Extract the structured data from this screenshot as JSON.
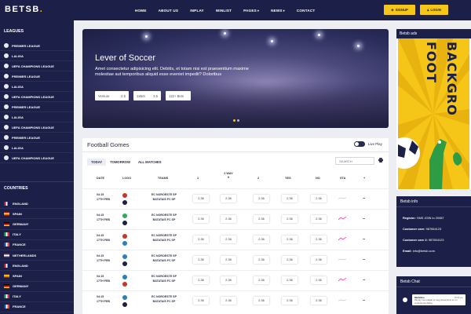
{
  "header": {
    "logo": "BETSB",
    "logo_dot": ".",
    "nav": [
      "HOME",
      "ABOUT US",
      "INPLAY",
      "WINLIST",
      "PAGES",
      "NEWS",
      "CONTACT"
    ],
    "nav_dropdowns": [
      "PAGES",
      "NEWS"
    ],
    "signup": "SIGNUP",
    "login": "LOGIN"
  },
  "sidebar": {
    "leagues_title": "LEAGUES",
    "leagues": [
      "PREMIER LEAGUE",
      "LALIGA",
      "UEFA CHAMPIONS LEAGUE",
      "PREMIER LEAGUE",
      "LALIGA",
      "UEFA CHAMPIONS LEAGUE",
      "PREMIER LEAGUE",
      "LALIGA",
      "UEFA CHAMPIONS LEAGUE",
      "PREMIER LEAGUE",
      "LALIGA",
      "UEFA CHAMPIONS LEAGUE"
    ],
    "countries_title": "COUNTRIES",
    "countries": [
      "ENGLAND",
      "SPAIN",
      "GERMANY",
      "ITALY",
      "FRANCE",
      "NETHERLANDS",
      "ENGLAND",
      "SPAIN",
      "GERMANY",
      "ITALY",
      "FRANCE"
    ]
  },
  "hero": {
    "title": "Lever of Soccer",
    "text": "Amet consectetur adipisicing elit. Debitis, et totam nisi est praesentium maxime molestiae aut temporibus aliquid esse eveniet impedit? Doloribus",
    "pills": [
      {
        "label": "Venture",
        "value": "2.5"
      },
      {
        "label": "1xBet",
        "value": "3.5"
      },
      {
        "label": "122+ Bets",
        "value": ""
      }
    ]
  },
  "games": {
    "title": "Football Gomes",
    "live_label": "Live Play",
    "tabs": [
      "TODAY",
      "TOMORROW",
      "ALL MATCHES"
    ],
    "search_placeholder": "SEARCH",
    "headers": {
      "date": "DATE",
      "logo": "LOGO",
      "teams": "TEAMS",
      "one": "1",
      "two_way": "2 WAY",
      "x": "X",
      "two": "2",
      "yes": "YES",
      "no": "NO",
      "sta": "STA",
      "plus": "+"
    },
    "rows": [
      {
        "time": "04:15",
        "date": "17TH FEB",
        "home": "EC NOROESTE SP",
        "away": "BATATAIS FC SP",
        "odds": [
          "2.36",
          "2.36",
          "2.36",
          "2.36",
          "2.36"
        ],
        "trend": "flat"
      },
      {
        "time": "04:15",
        "date": "17TH FEB",
        "home": "EC NOROESTE SP",
        "away": "BATATAIS FC SP",
        "odds": [
          "2.36",
          "2.36",
          "2.36",
          "2.36",
          "2.36"
        ],
        "trend": "up"
      },
      {
        "time": "04:15",
        "date": "17TH FEB",
        "home": "EC NOROESTE SP",
        "away": "BATATAIS FC SP",
        "odds": [
          "2.36",
          "2.36",
          "2.36",
          "2.36",
          "2.36"
        ],
        "trend": "up"
      },
      {
        "time": "04:15",
        "date": "17TH FEB",
        "home": "EC NOROESTE SP",
        "away": "BATATAIS FC SP",
        "odds": [
          "2.36",
          "2.36",
          "2.36",
          "2.36",
          "2.36"
        ],
        "trend": "flat"
      },
      {
        "time": "04:15",
        "date": "17TH FEB",
        "home": "EC NOROESTE SP",
        "away": "BATATAIS FC SP",
        "odds": [
          "2.36",
          "2.36",
          "2.36",
          "2.36",
          "2.36"
        ],
        "trend": "up"
      },
      {
        "time": "04:15",
        "date": "17TH FEB",
        "home": "EC NOROESTE SP",
        "away": "BATATAIS FC SP",
        "odds": [
          "2.36",
          "2.36",
          "2.36",
          "2.36",
          "2.36"
        ],
        "trend": "flat"
      }
    ]
  },
  "ads": {
    "title": "Betsb ads",
    "image_text_1": "FOOT",
    "image_text_2": "BACKGRO"
  },
  "info": {
    "title": "Betsb info",
    "register_label": "Register:",
    "register_value": "SMS JOIN to 20087",
    "care1_label": "Customer care:",
    "care1_value": "987654123",
    "care2_label": "Customer care 2:",
    "care2_value": "987654123",
    "email_label": "Email:",
    "email_value": "info@betsb.com"
  },
  "chat": {
    "title": "Betsb Chat",
    "name": "Madeline",
    "time": "10:00 pm",
    "text": "We lay mes pagan en seg preeemnos en mi conferencia dialog"
  },
  "colors": {
    "navy": "#1c2048",
    "yellow": "#f5c518",
    "pink": "#ff3ba1",
    "panel": "#ffffff"
  }
}
